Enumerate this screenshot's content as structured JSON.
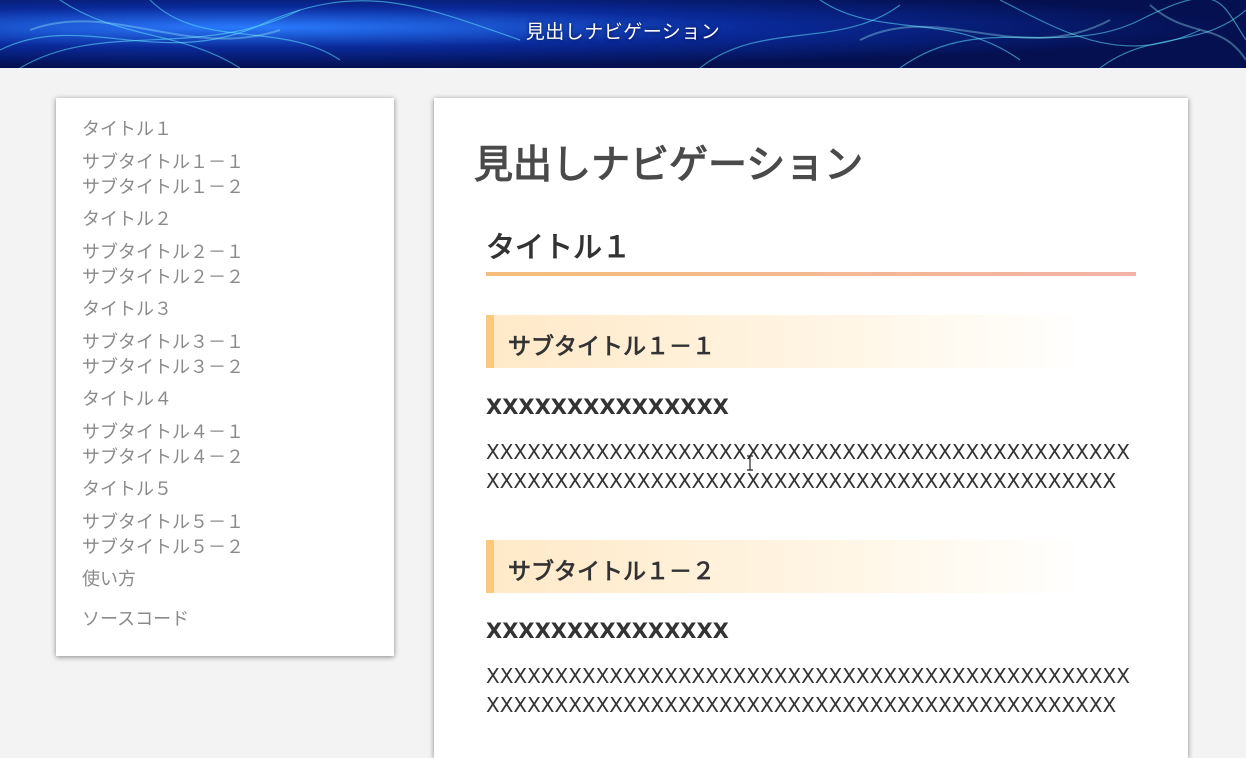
{
  "header": {
    "title": "見出しナビゲーション"
  },
  "sidebar": {
    "items": [
      {
        "label": "タイトル１"
      },
      {
        "label": "サブタイトル１－１"
      },
      {
        "label": "サブタイトル１－２"
      },
      {
        "label": "タイトル２"
      },
      {
        "label": "サブタイトル２－１"
      },
      {
        "label": "サブタイトル２－２"
      },
      {
        "label": "タイトル３"
      },
      {
        "label": "サブタイトル３－１"
      },
      {
        "label": "サブタイトル３－２"
      },
      {
        "label": "タイトル４"
      },
      {
        "label": "サブタイトル４－１"
      },
      {
        "label": "サブタイトル４－２"
      },
      {
        "label": "タイトル５"
      },
      {
        "label": "サブタイトル５－１"
      },
      {
        "label": "サブタイトル５－２"
      },
      {
        "label": "使い方"
      },
      {
        "label": "ソースコード"
      }
    ]
  },
  "main": {
    "page_title": "見出しナビゲーション",
    "section_title": "タイトル１",
    "subsections": [
      {
        "title": "サブタイトル１－１",
        "heading": "XXXXXXXXXXXXXXX",
        "paragraph": "XXXXXXXXXXXXXXXXXXXXXXXXXXXXXXXXXXXXXXXXXXXXXXXXXXXXXXXXXXXXXXXXXXXXXXXXXXXXXXXXXXXXXXXXXXXXX"
      },
      {
        "title": "サブタイトル１－２",
        "heading": "XXXXXXXXXXXXXXX",
        "paragraph": "XXXXXXXXXXXXXXXXXXXXXXXXXXXXXXXXXXXXXXXXXXXXXXXXXXXXXXXXXXXXXXXXXXXXXXXXXXXXXXXXXXXXXXXXXXXXX"
      }
    ]
  },
  "colors": {
    "h2_underline": "#f6be7a",
    "h3_accent": "#fbc97e",
    "nav_text": "#8a8a8a",
    "background": "#f3f3f3"
  }
}
